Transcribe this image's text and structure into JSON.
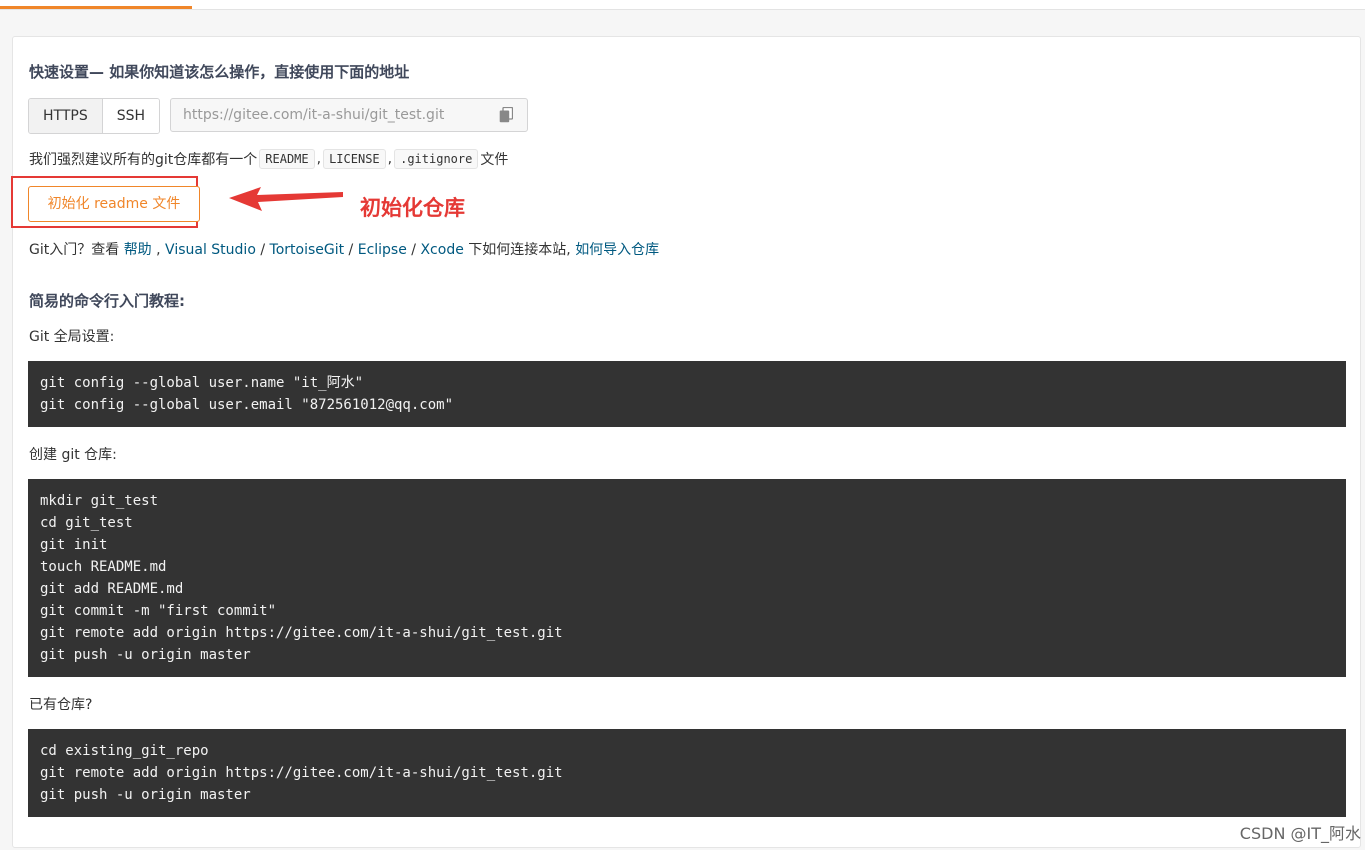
{
  "quick_setup": {
    "title": "快速设置— 如果你知道该怎么操作，直接使用下面的地址",
    "protocols": [
      "HTTPS",
      "SSH"
    ],
    "url": "https://gitee.com/it-a-shui/git_test.git"
  },
  "recommend": {
    "prefix": "我们强烈建议所有的git仓库都有一个",
    "files": [
      "README",
      "LICENSE",
      ".gitignore"
    ],
    "sep": ",",
    "suffix": "文件"
  },
  "init_button": {
    "label": "初始化 readme 文件"
  },
  "annotation": {
    "text": "初始化仓库"
  },
  "help_links": {
    "prefix": "Git入门？查看",
    "help": "帮助",
    "visual_studio": "Visual Studio",
    "tortoisegit": "TortoiseGit",
    "eclipse": "Eclipse",
    "xcode": "Xcode",
    "middle": "下如何连接本站,",
    "import": "如何导入仓库"
  },
  "tutorial": {
    "title": "简易的命令行入门教程:",
    "global_label": "Git 全局设置:",
    "global_code": [
      "git config --global user.name \"it_阿水\"",
      "git config --global user.email \"872561012@qq.com\""
    ],
    "create_label": "创建 git 仓库:",
    "create_code": [
      "mkdir git_test",
      "cd git_test",
      "git init",
      "touch README.md",
      "git add README.md",
      "git commit -m \"first commit\"",
      "git remote add origin https://gitee.com/it-a-shui/git_test.git",
      "git push -u origin master"
    ],
    "existing_label": "已有仓库?",
    "existing_code": [
      "cd existing_git_repo",
      "git remote add origin https://gitee.com/it-a-shui/git_test.git",
      "git push -u origin master"
    ]
  },
  "watermark": "CSDN @IT_阿水",
  "colors": {
    "accent": "#f0862a",
    "annotation": "#e53935",
    "link": "#005980",
    "code_bg": "#333333"
  }
}
